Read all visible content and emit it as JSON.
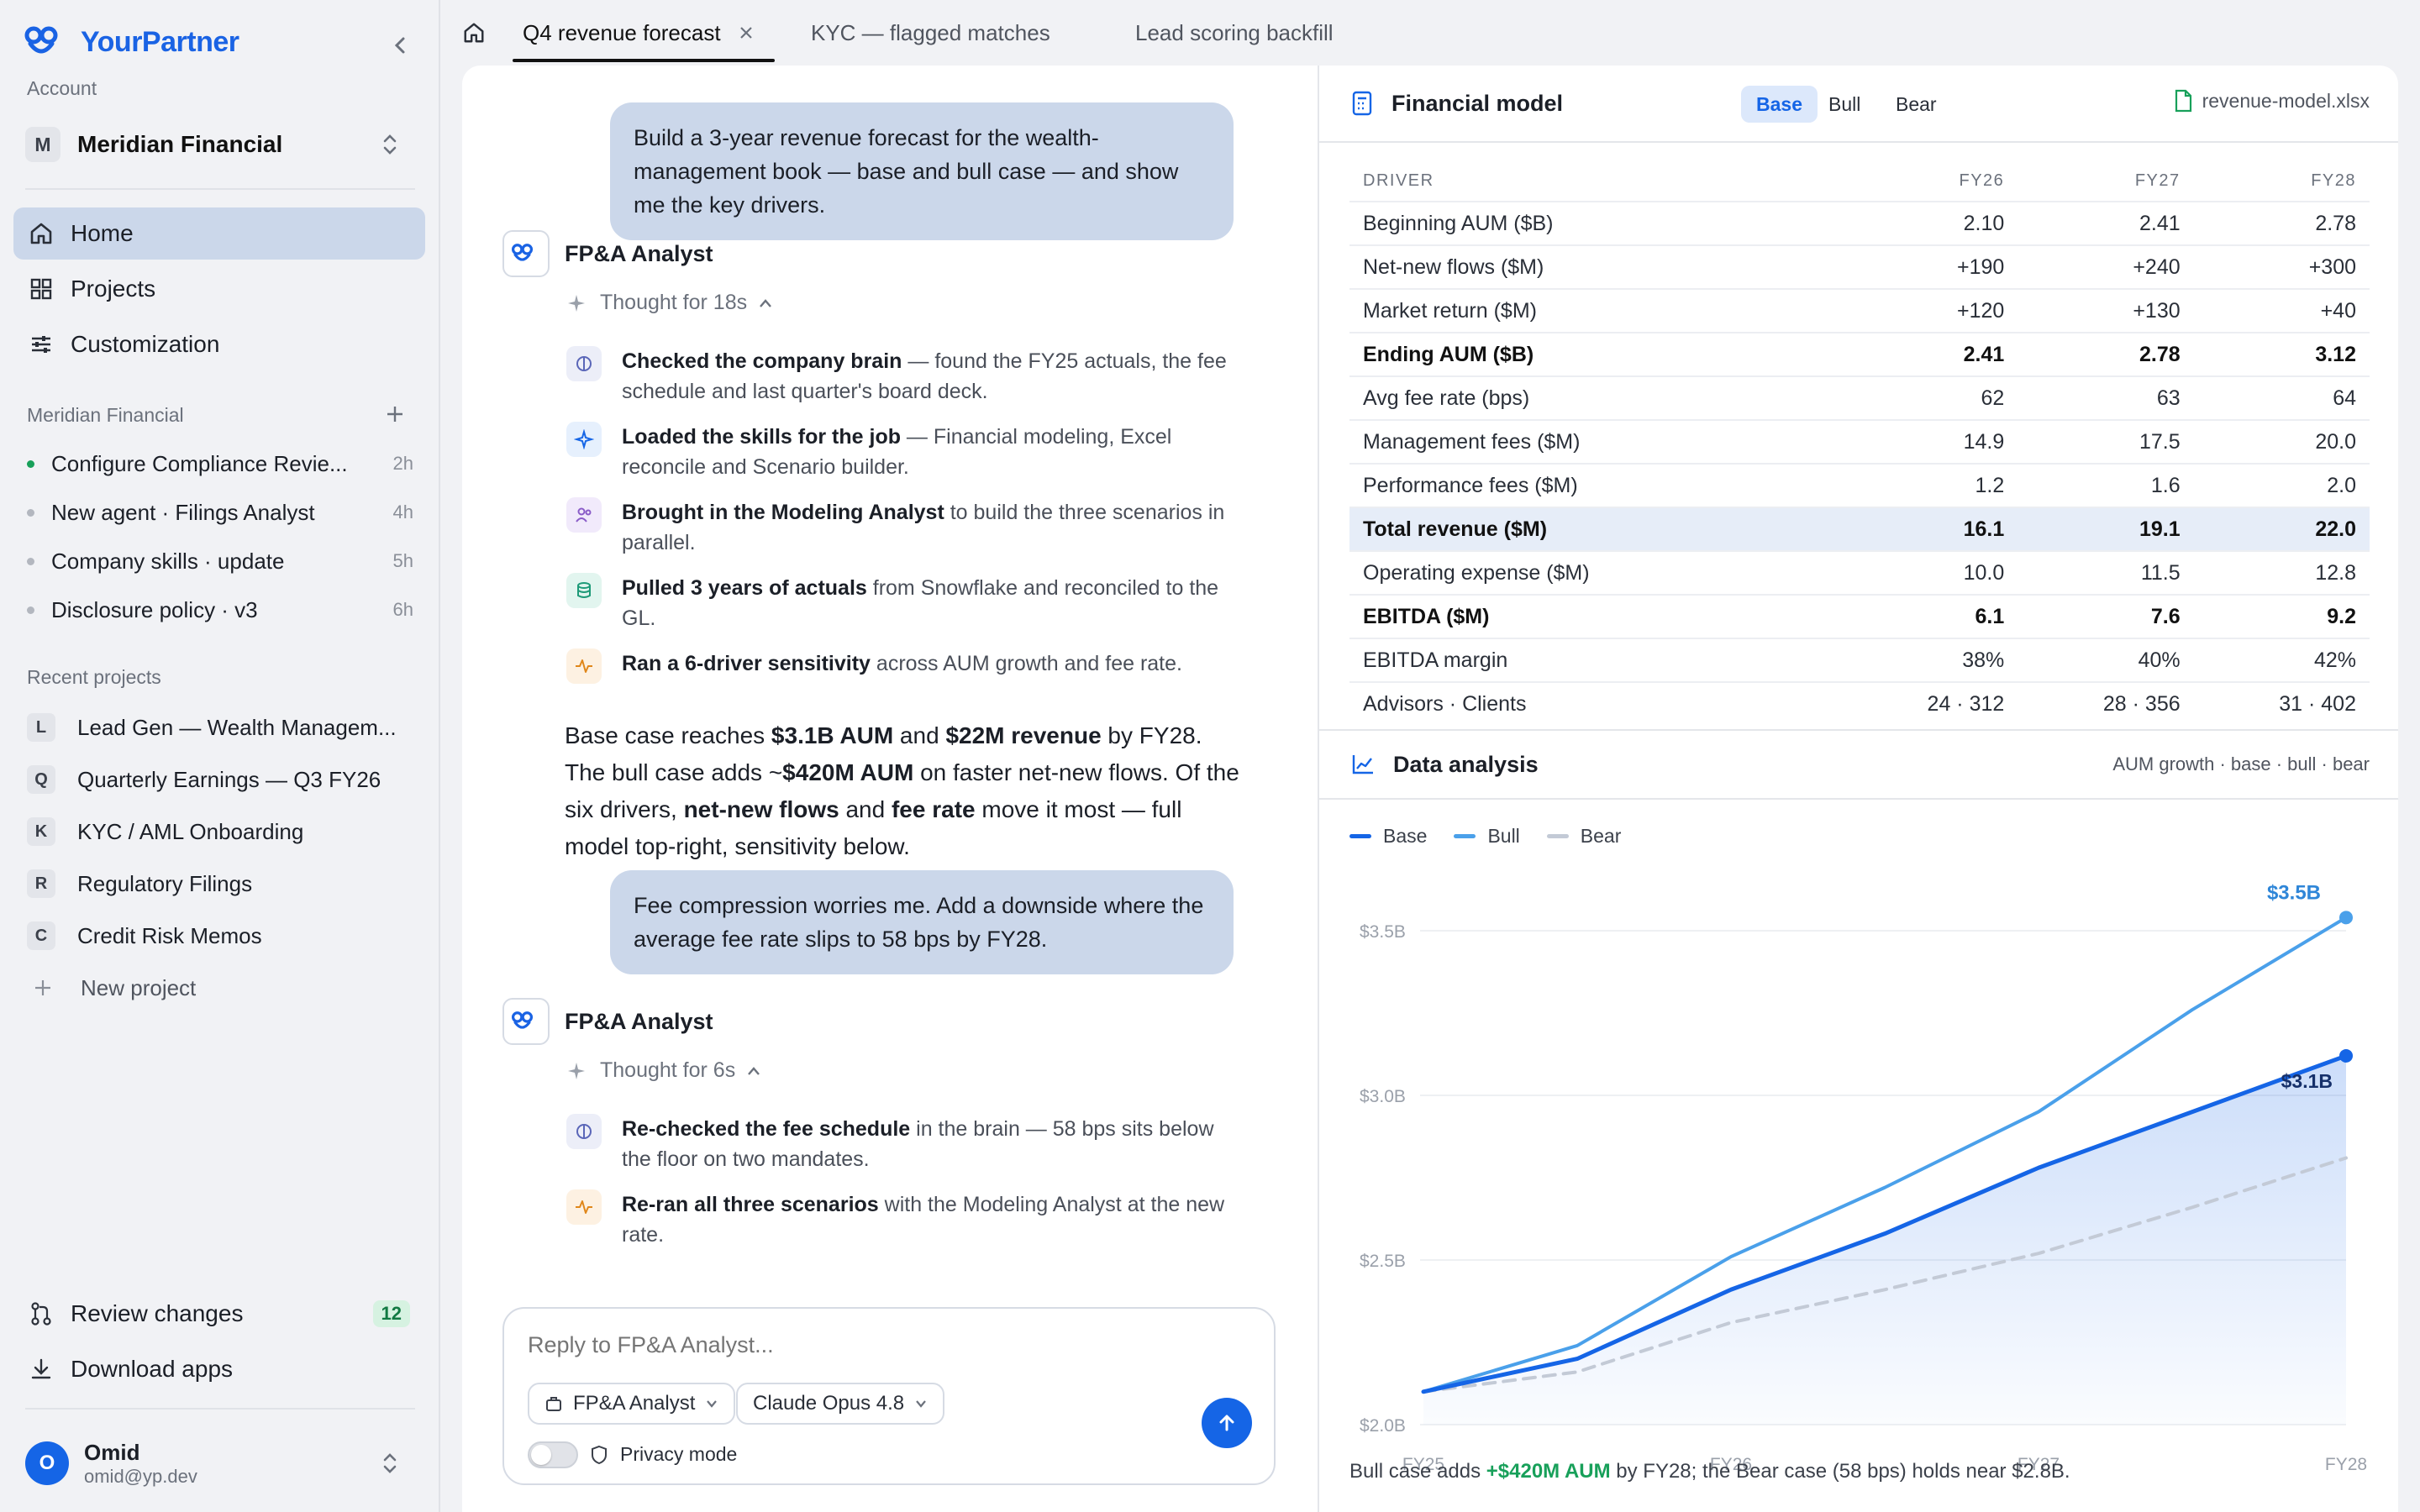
{
  "app": {
    "brand": "YourPartner",
    "account_label": "Account",
    "account_initial": "M",
    "account_name": "Meridian Financial"
  },
  "nav": [
    {
      "label": "Home",
      "icon": "home-icon"
    },
    {
      "label": "Projects",
      "icon": "grid-icon"
    },
    {
      "label": "Customization",
      "icon": "sliders-icon"
    }
  ],
  "agents_section": {
    "title": "Meridian Financial",
    "items": [
      {
        "label": "Configure Compliance Revie...",
        "time": "2h",
        "status": "active"
      },
      {
        "label": "New agent · Filings Analyst",
        "time": "4h",
        "status": "idle"
      },
      {
        "label": "Company skills · update",
        "time": "5h",
        "status": "idle"
      },
      {
        "label": "Disclosure policy · v3",
        "time": "6h",
        "status": "idle"
      }
    ]
  },
  "recent": {
    "title": "Recent projects",
    "items": [
      {
        "initial": "L",
        "label": "Lead Gen — Wealth Managem..."
      },
      {
        "initial": "Q",
        "label": "Quarterly Earnings — Q3 FY26"
      },
      {
        "initial": "K",
        "label": "KYC / AML Onboarding"
      },
      {
        "initial": "R",
        "label": "Regulatory Filings"
      },
      {
        "initial": "C",
        "label": "Credit Risk Memos"
      }
    ],
    "new_label": "New project"
  },
  "footer": {
    "review_label": "Review changes",
    "review_count": "12",
    "download_label": "Download apps",
    "user_initial": "O",
    "user_name": "Omid",
    "user_email": "omid@yp.dev"
  },
  "tabs": [
    {
      "label": "Q4 revenue forecast",
      "active": true
    },
    {
      "label": "KYC — flagged matches"
    },
    {
      "label": "Lead scoring backfill"
    }
  ],
  "chat": {
    "user_msg_1": "Build a 3-year revenue forecast for the wealth-management book — base and bull case — and show me the key drivers.",
    "agent_name": "FP&A Analyst",
    "thought_1": "Thought for 18s",
    "steps_1": [
      {
        "bold": "Checked the company brain",
        "rest": " — found the FY25 actuals, the fee schedule and last quarter's board deck."
      },
      {
        "bold": "Loaded the skills for the job",
        "rest": " — Financial modeling, Excel reconcile and Scenario builder."
      },
      {
        "bold": "Brought in the Modeling Analyst",
        "rest": " to build the three scenarios in parallel."
      },
      {
        "bold": "Pulled 3 years of actuals",
        "rest": " from Snowflake and reconciled to the GL."
      },
      {
        "bold": "Ran a 6-driver sensitivity",
        "rest": " across AUM growth and fee rate."
      }
    ],
    "summary": {
      "s1": "Base case reaches ",
      "b1": "$3.1B AUM",
      "s2": " and ",
      "b2": "$22M revenue",
      "s3": " by FY28. The bull case adds ~",
      "b3": "$420M AUM",
      "s4": " on faster net-new flows. Of the six drivers, ",
      "b4": "net-new flows",
      "s5": " and ",
      "b5": "fee rate",
      "s6": " move it most — full model top-right, sensitivity below."
    },
    "user_msg_2": "Fee compression worries me. Add a downside where the average fee rate slips to 58 bps by FY28.",
    "thought_2": "Thought for 6s",
    "steps_2": [
      {
        "bold": "Re-checked the fee schedule",
        "rest": " in the brain — 58 bps sits below the floor on two mandates."
      },
      {
        "bold": "Re-ran all three scenarios",
        "rest": " with the Modeling Analyst at the new rate."
      }
    ],
    "composer": {
      "placeholder": "Reply to FP&A Analyst...",
      "agent_pill": "FP&A Analyst",
      "model_pill": "Claude Opus 4.8",
      "privacy_label": "Privacy mode"
    }
  },
  "model": {
    "title": "Financial model",
    "scenarios": [
      "Base",
      "Bull",
      "Bear"
    ],
    "active_scenario": "Base",
    "file": "revenue-model.xlsx",
    "columns": [
      "DRIVER",
      "FY26",
      "FY27",
      "FY28"
    ],
    "rows": [
      {
        "label": "Beginning AUM ($B)",
        "v": [
          "2.10",
          "2.41",
          "2.78"
        ]
      },
      {
        "label": "Net-new flows ($M)",
        "v": [
          "+190",
          "+240",
          "+300"
        ]
      },
      {
        "label": "Market return ($M)",
        "v": [
          "+120",
          "+130",
          "+40"
        ]
      },
      {
        "label": "Ending AUM ($B)",
        "v": [
          "2.41",
          "2.78",
          "3.12"
        ],
        "bold": true
      },
      {
        "label": "Avg fee rate (bps)",
        "v": [
          "62",
          "63",
          "64"
        ]
      },
      {
        "label": "Management fees ($M)",
        "v": [
          "14.9",
          "17.5",
          "20.0"
        ]
      },
      {
        "label": "Performance fees ($M)",
        "v": [
          "1.2",
          "1.6",
          "2.0"
        ]
      },
      {
        "label": "Total revenue ($M)",
        "v": [
          "16.1",
          "19.1",
          "22.0"
        ],
        "bold": true,
        "highlight": true
      },
      {
        "label": "Operating expense ($M)",
        "v": [
          "10.0",
          "11.5",
          "12.8"
        ]
      },
      {
        "label": "EBITDA ($M)",
        "v": [
          "6.1",
          "7.6",
          "9.2"
        ],
        "bold": true
      },
      {
        "label": "EBITDA margin",
        "v": [
          "38%",
          "40%",
          "42%"
        ]
      },
      {
        "label": "Advisors · Clients",
        "v": [
          "24 · 312",
          "28 · 356",
          "31 · 402"
        ]
      }
    ]
  },
  "analysis": {
    "title": "Data analysis",
    "subtitle": "AUM growth · base · bull · bear",
    "note": {
      "a": "Bull case adds ",
      "b": "+$420M AUM",
      "c": " by FY28; the Bear case (58 bps) holds near $2.8B."
    }
  },
  "chart_data": {
    "type": "line",
    "x": [
      "FY25",
      "FY25.5",
      "FY26",
      "FY26.5",
      "FY27",
      "FY27.5",
      "FY28"
    ],
    "x_ticks": [
      "FY25",
      "FY26",
      "FY27",
      "FY28"
    ],
    "y_ticks": [
      "$2.0B",
      "$2.5B",
      "$3.0B",
      "$3.5B"
    ],
    "ylim": [
      2.0,
      3.5
    ],
    "series": [
      {
        "name": "Base",
        "color": "#1565e6",
        "values": [
          2.1,
          2.2,
          2.41,
          2.58,
          2.78,
          2.95,
          3.12
        ],
        "end_label": "$3.1B"
      },
      {
        "name": "Bull",
        "color": "#4aa0ea",
        "values": [
          2.1,
          2.24,
          2.51,
          2.72,
          2.95,
          3.26,
          3.54
        ],
        "end_label": "$3.5B"
      },
      {
        "name": "Bear",
        "color": "#c3cad6",
        "values": [
          2.1,
          2.16,
          2.31,
          2.41,
          2.52,
          2.66,
          2.81
        ]
      }
    ],
    "grid": true,
    "legend": "top-left"
  },
  "colors": {
    "accent": "#1565e6",
    "active_nav": "#cbd7ea",
    "user_bubble": "#cbd7ea",
    "success": "#18a05a"
  }
}
